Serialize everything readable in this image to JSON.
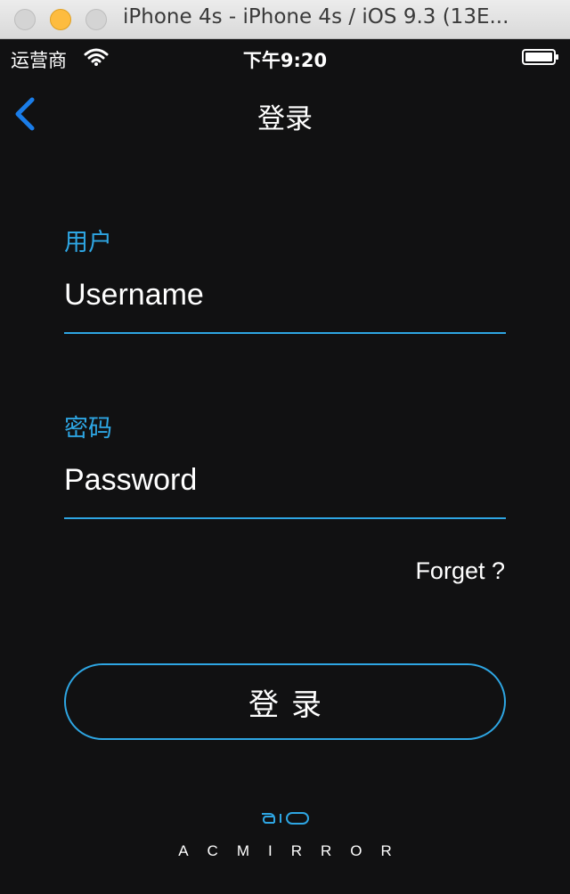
{
  "window": {
    "title": "iPhone 4s - iPhone 4s / iOS 9.3 (13E..."
  },
  "status_bar": {
    "carrier": "运营商",
    "time": "下午9:20",
    "icons": [
      "wifi-icon",
      "battery-icon"
    ]
  },
  "nav": {
    "title": "登录",
    "back_icon": "chevron-left-icon"
  },
  "form": {
    "username_label": "用户",
    "username_placeholder": "Username",
    "password_label": "密码",
    "password_placeholder": "Password",
    "forget_label": "Forget ?",
    "login_label": "登录"
  },
  "brand": {
    "name": "ACMIRROR"
  },
  "colors": {
    "background": "#111112",
    "accent": "#2ea6e3",
    "back_chevron": "#1a7de9",
    "text": "#ffffff"
  }
}
